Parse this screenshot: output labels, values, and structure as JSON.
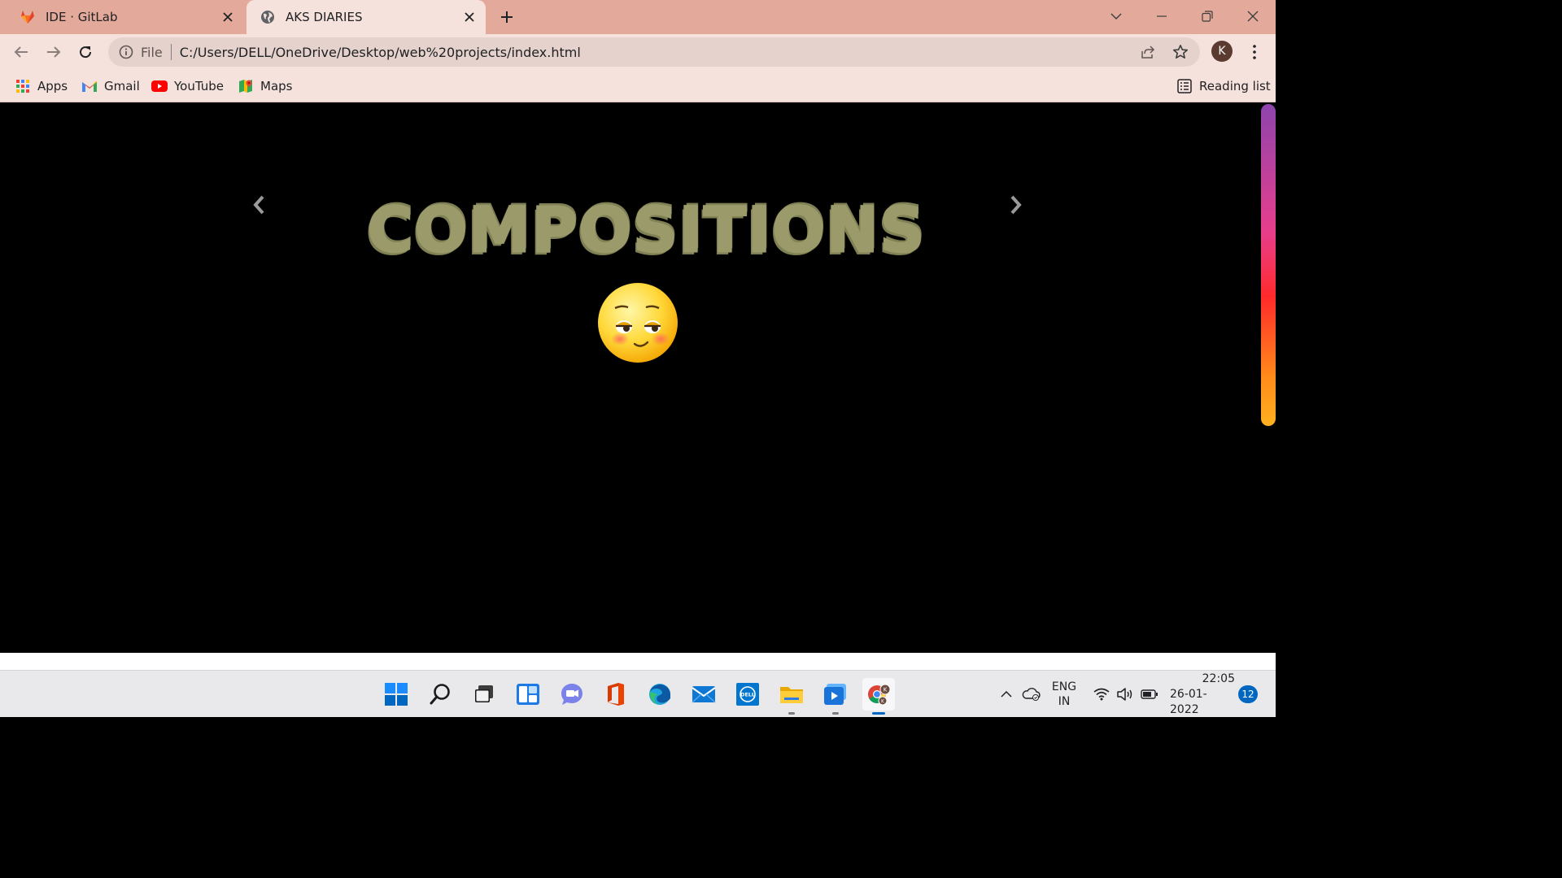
{
  "browser": {
    "tabs": [
      {
        "title": "IDE · GitLab",
        "icon": "gitlab-icon",
        "active": false
      },
      {
        "title": "AKS DIARIES",
        "icon": "globe-icon",
        "active": true
      }
    ],
    "address": {
      "scheme_label": "File",
      "url": "C:/Users/DELL/OneDrive/Desktop/web%20projects/index.html"
    },
    "profile_initial": "K",
    "bookmarks": [
      {
        "label": "Apps",
        "icon": "apps-grid-icon"
      },
      {
        "label": "Gmail",
        "icon": "gmail-icon"
      },
      {
        "label": "YouTube",
        "icon": "youtube-icon"
      },
      {
        "label": "Maps",
        "icon": "maps-icon"
      }
    ],
    "reading_list_label": "Reading list"
  },
  "page": {
    "hero_title": "COMPOSITIONS",
    "hero_color": "#9a9a6a",
    "emoji_icon": "flushed-smirk-emoji-icon"
  },
  "taskbar": {
    "apps": [
      "start-icon",
      "search-icon",
      "task-view-icon",
      "widgets-icon",
      "teams-chat-icon",
      "office-icon",
      "edge-icon",
      "mail-icon",
      "dell-icon",
      "file-explorer-icon",
      "media-player-icon",
      "chrome-icon"
    ],
    "language_line1": "ENG",
    "language_line2": "IN",
    "time": "22:05",
    "date": "26-01-2022",
    "notification_count": "12"
  }
}
